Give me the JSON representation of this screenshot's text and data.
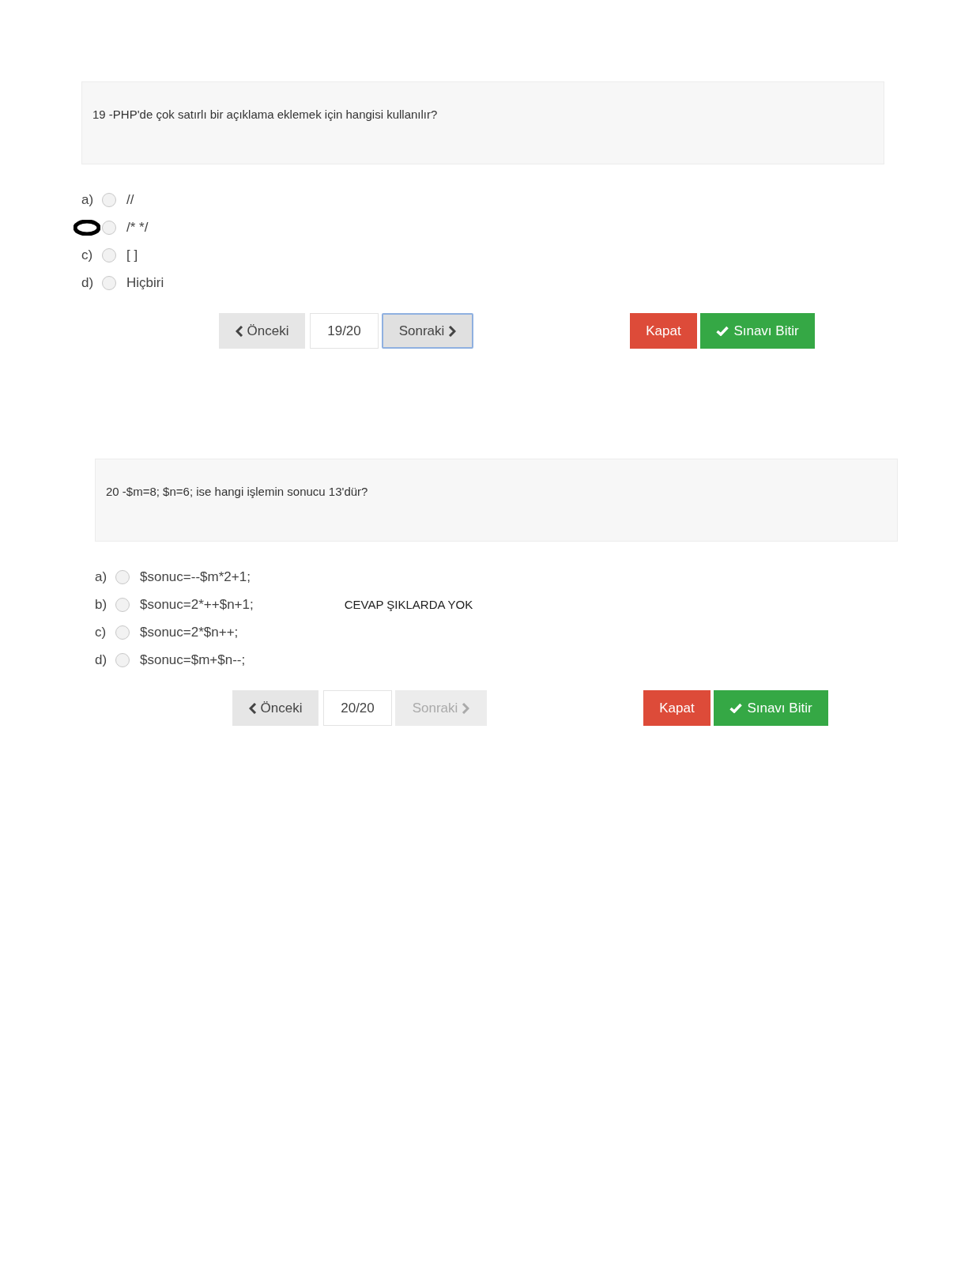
{
  "questions": [
    {
      "text": "19 -PHP'de çok satırlı bir açıklama eklemek için hangisi kullanılır?",
      "options": [
        {
          "label": "a)",
          "selected": false,
          "marked": false,
          "text": "//"
        },
        {
          "selected": false,
          "marked": true,
          "text": "/* */"
        },
        {
          "label": "c)",
          "selected": false,
          "marked": false,
          "text": "[ ]"
        },
        {
          "label": "d)",
          "selected": false,
          "marked": false,
          "text": "Hiçbiri"
        }
      ],
      "nav": {
        "prev": "Önceki",
        "counter": "19/20",
        "next": "Sonraki",
        "next_disabled": false,
        "next_focused": true,
        "close": "Kapat",
        "finish": "Sınavı Bitir"
      }
    },
    {
      "text": "20 -$m=8; $n=6; ise hangi işlemin sonucu 13'dür?",
      "note": "CEVAP ŞIKLARDA YOK",
      "options": [
        {
          "label": "a)",
          "selected": false,
          "marked": false,
          "text": "$sonuc=--$m*2+1;"
        },
        {
          "label": "b)",
          "selected": false,
          "marked": false,
          "text": "$sonuc=2*++$n+1;"
        },
        {
          "label": "c)",
          "selected": false,
          "marked": false,
          "text": "$sonuc=2*$n++;"
        },
        {
          "label": "d)",
          "selected": false,
          "marked": false,
          "text": "$sonuc=$m+$n--;"
        }
      ],
      "nav": {
        "prev": "Önceki",
        "counter": "20/20",
        "next": "Sonraki",
        "next_disabled": true,
        "next_focused": false,
        "close": "Kapat",
        "finish": "Sınavı Bitir"
      }
    }
  ]
}
